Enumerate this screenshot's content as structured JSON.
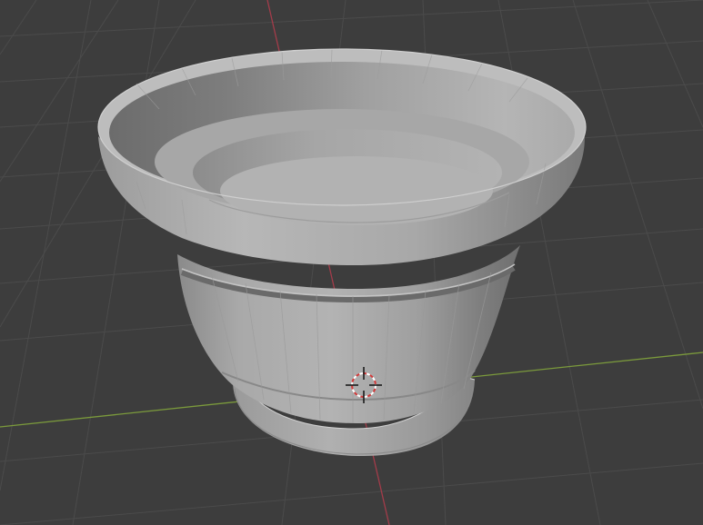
{
  "app": "3D Viewport",
  "viewport": {
    "background_color": "#3d3d3d",
    "grid_color": "#4a4a4a",
    "x_axis_color": "#7b9a3c",
    "y_axis_color": "#a33c4a"
  },
  "object": {
    "shading": "solid",
    "base_color": "#9a9a9a"
  },
  "cursor": {
    "icon": "3d-cursor-icon"
  }
}
